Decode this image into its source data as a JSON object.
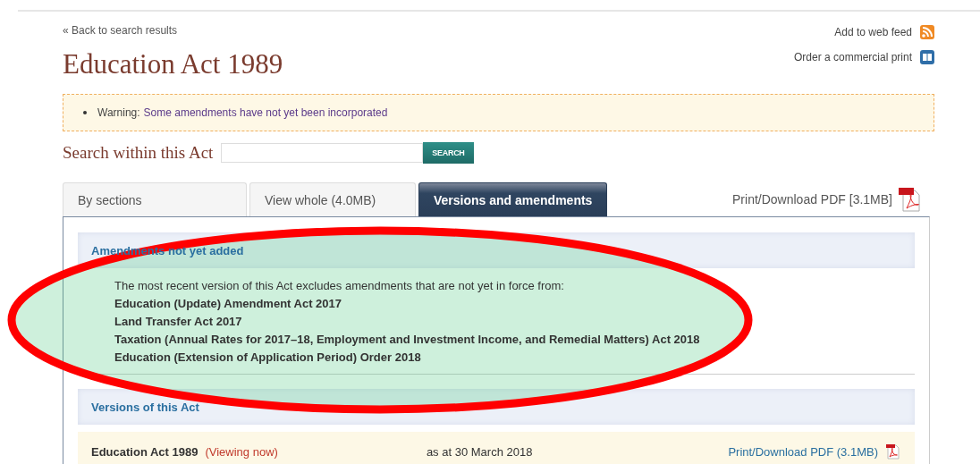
{
  "back_link": "« Back to search results",
  "title": "Education Act 1989",
  "actions": [
    {
      "label": "Add to web feed",
      "kind": "feed"
    },
    {
      "label": "Order a commercial print",
      "kind": "print"
    }
  ],
  "warning": {
    "label": "Warning:",
    "text": "Some amendments have not yet been incorporated"
  },
  "search": {
    "label": "Search within this Act",
    "button": "SEARCH"
  },
  "tabs": [
    {
      "label": "By sections",
      "selected": false
    },
    {
      "label": "View whole (4.0MB)",
      "selected": false
    },
    {
      "label": "Versions and amendments",
      "selected": true
    }
  ],
  "tab_pdf": "Print/Download PDF [3.1MB]",
  "amendments": {
    "heading": "Amendments not yet added",
    "intro": "The most recent version of this Act excludes amendments that are not yet in force from:",
    "items": [
      "Education (Update) Amendment Act 2017",
      "Land Transfer Act 2017",
      "Taxation (Annual Rates for 2017–18, Employment and Investment Income, and Remedial Matters) Act 2018",
      "Education (Extension of Application Period) Order 2018"
    ]
  },
  "versions": {
    "heading": "Versions of this Act",
    "rows": [
      {
        "title": "Education Act 1989",
        "status": "(Viewing now)",
        "date": "as at 30 March 2018",
        "pdf": "Print/Download PDF (3.1MB)"
      }
    ]
  },
  "highlight": {
    "kind": "ellipse"
  }
}
